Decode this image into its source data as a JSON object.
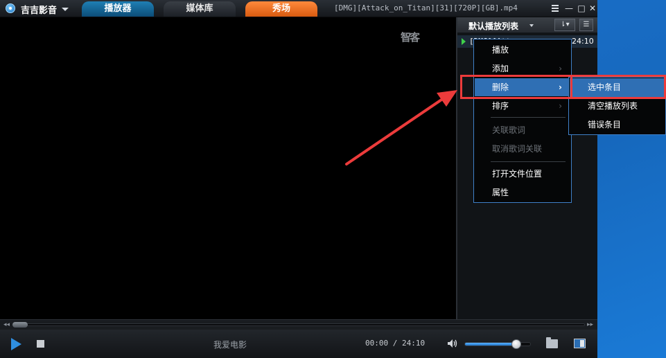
{
  "app": {
    "name": "吉吉影音",
    "tabs": [
      {
        "label": "播放器"
      },
      {
        "label": "媒体库"
      },
      {
        "label": "秀场"
      }
    ],
    "file_title": "[DMG][Attack_on_Titan][31][720P][GB].mp4",
    "window_buttons": {
      "menu_icon": "menu-lines-icon",
      "minimize": "—",
      "maximize": "□",
      "close": "✕"
    }
  },
  "video": {
    "watermark": "智客"
  },
  "playlist": {
    "title": "默认播放列表",
    "sort_button": "⇂▾",
    "view_button": "☰",
    "items": [
      {
        "name": "[DMG][Att",
        "duration": "24:10"
      }
    ]
  },
  "context_menu": {
    "items": [
      {
        "label": "播放"
      },
      {
        "label": "添加",
        "arrow": "›"
      },
      {
        "label": "删除",
        "arrow": "›"
      },
      {
        "label": "排序",
        "arrow": "›"
      },
      {
        "label": "关联歌词"
      },
      {
        "label": "取消歌词关联"
      },
      {
        "label": "打开文件位置"
      },
      {
        "label": "属性"
      }
    ],
    "submenu": [
      {
        "label": "选中条目"
      },
      {
        "label": "清空播放列表"
      },
      {
        "label": "错误条目"
      }
    ]
  },
  "seek": {
    "left_arrows": "◂◂",
    "right_arrows": "▸▸",
    "position_fraction": 0
  },
  "controls": {
    "now_playing": "我爱电影",
    "time": "00:00 / 24:10",
    "volume_fraction": 0.78
  },
  "colors": {
    "accent": "#2f6fb4",
    "highlight_box": "#ec3b3b",
    "player_tab": "#1f7fb4",
    "show_tab": "#ff8a3c"
  }
}
